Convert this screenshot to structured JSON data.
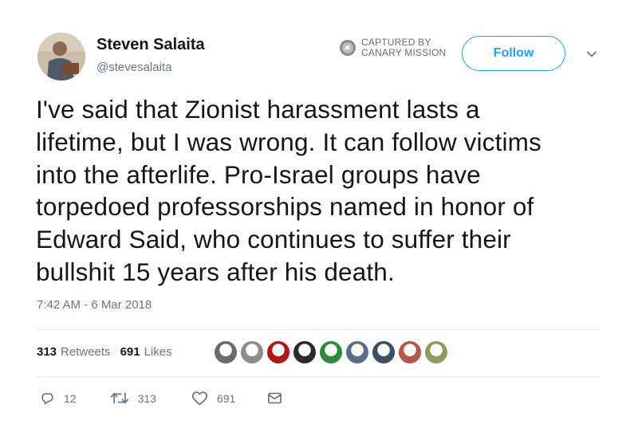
{
  "user": {
    "name": "Steven Salaita",
    "handle": "@stevesalaita"
  },
  "captured": {
    "line1": "CAPTURED BY",
    "line2": "CANARY MISSION"
  },
  "follow_label": "Follow",
  "tweet": {
    "lines": [
      "I've said that Zionist harassment lasts a",
      "lifetime, but I was wrong. It can follow victims",
      "into the afterlife. Pro-Israel groups have",
      "torpedoed professorships named in honor of",
      "Edward Said, who continues to suffer their",
      "bullshit 15 years after his death."
    ],
    "timestamp": "7:42 AM - 6 Mar 2018"
  },
  "stats": {
    "retweets": "313",
    "retweets_label": "Retweets",
    "likes": "691",
    "likes_label": "Likes"
  },
  "likers": [
    {
      "icon": "liker-avatar-1",
      "color": "#6b6b6b"
    },
    {
      "icon": "liker-avatar-2",
      "color": "#8a8f86"
    },
    {
      "icon": "liker-avatar-3",
      "color": "#b01818"
    },
    {
      "icon": "liker-avatar-4",
      "color": "#2b2b2b"
    },
    {
      "icon": "liker-avatar-5",
      "color": "#2e8b3a"
    },
    {
      "icon": "liker-avatar-6",
      "color": "#5a6f86"
    },
    {
      "icon": "liker-avatar-7",
      "color": "#3c4f63"
    },
    {
      "icon": "liker-avatar-8",
      "color": "#b5584b"
    },
    {
      "icon": "liker-avatar-9",
      "color": "#8aa05a"
    }
  ],
  "actions": {
    "reply_count": "12",
    "retweet_count": "313",
    "like_count": "691"
  },
  "colors": {
    "accent": "#1da1f2",
    "muted": "#657786",
    "text": "#14171a",
    "divider": "#e6ecf0"
  }
}
